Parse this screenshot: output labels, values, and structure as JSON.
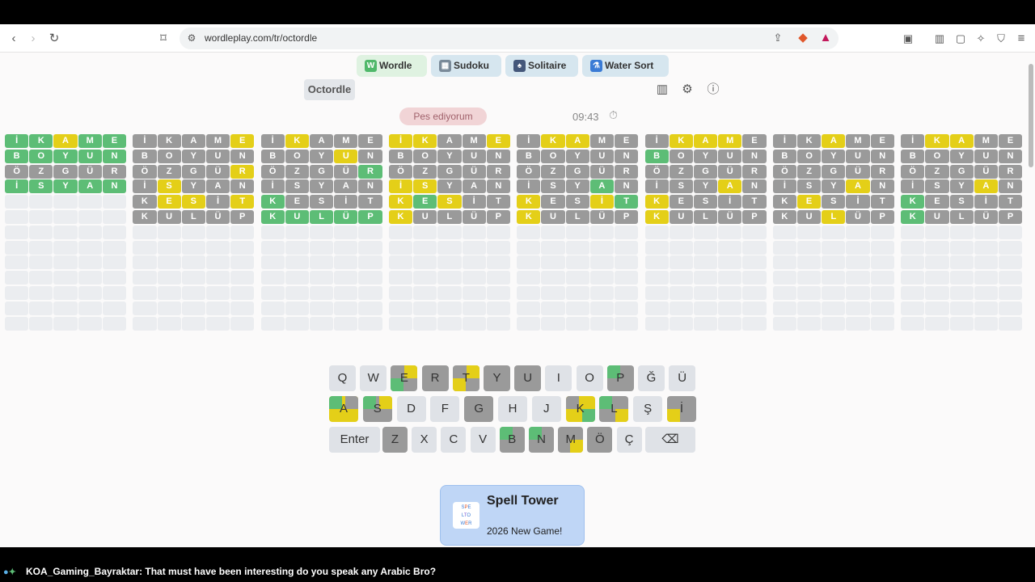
{
  "browser": {
    "url": "wordleplay.com/tr/octordle",
    "back_icon": "back-icon",
    "forward_icon": "forward-icon",
    "reload_icon": "reload-icon"
  },
  "nav": [
    {
      "label": "Wordle",
      "icon": "W",
      "color": "#dff2e1",
      "icon_color": "#4fb86a"
    },
    {
      "label": "Sudoku",
      "icon": "▦",
      "color": "#d6e6ef",
      "icon_color": "#7a8a99"
    },
    {
      "label": "Solitaire",
      "icon": "♠",
      "color": "#d6e6ef",
      "icon_color": "#44577a"
    },
    {
      "label": "Water Sort",
      "icon": "⚗",
      "color": "#d6e6ef",
      "icon_color": "#3a7bd5"
    }
  ],
  "game": {
    "title": "Octordle",
    "give_up": "Pes ediyorum",
    "timer": "09:43"
  },
  "words": [
    "İKAME",
    "BOYUN",
    "ÖZGÜR",
    "İSYAN",
    "KESİT",
    "KULÜP"
  ],
  "boards": [
    {
      "rows": [
        "nnynn",
        "nnnnn",
        "ggggg",
        "nnnnn"
      ]
    },
    {
      "rows": [
        "ggggy",
        "ggggg",
        "ggggy",
        "gyggg",
        "gyygy",
        "ggggg"
      ]
    },
    {
      "rows": [
        "gyggg",
        "gggyg",
        "ggggn",
        "ggggg",
        "ngggg",
        "nnnnn"
      ]
    },
    {
      "rows": [
        "yyggy",
        "ggggg",
        "ggggg",
        "yyggg",
        "ynygg",
        "ygggg"
      ]
    },
    {
      "rows": [
        "gyygg",
        "ggggg",
        "ggggg",
        "gggng",
        "yggyn",
        "ygggg"
      ]
    },
    {
      "rows": [
        "gyyyg",
        "nggg g",
        "ggggg",
        "gggyg",
        "ygggg",
        "ygggg"
      ]
    },
    {
      "rows": [
        "ggyggn",
        "ggggg",
        "ggggg",
        "gggyg",
        "gyggg",
        "ggygg"
      ]
    },
    {
      "rows": [
        "gyygg",
        "ggggg",
        "ggggg",
        "gggyg",
        "nggggy",
        "ngggg"
      ]
    }
  ],
  "keyboard": {
    "row1": [
      "Q",
      "W",
      "E",
      "R",
      "T",
      "Y",
      "U",
      "I",
      "O",
      "P",
      "Ğ",
      "Ü"
    ],
    "row2": [
      "A",
      "S",
      "D",
      "F",
      "G",
      "H",
      "J",
      "K",
      "L",
      "Ş",
      "İ"
    ],
    "row3": [
      "Enter",
      "Z",
      "X",
      "C",
      "V",
      "B",
      "N",
      "M",
      "Ö",
      "Ç",
      "⌫"
    ]
  },
  "ad": {
    "title": "Spell Tower",
    "subtitle": "2026 New Game!",
    "logo_text": "SPE LTO WER"
  },
  "chat": {
    "user": "KOA_Gaming_Bayraktar",
    "message": ": That must have been interesting do you speak any Arabic Bro?"
  }
}
